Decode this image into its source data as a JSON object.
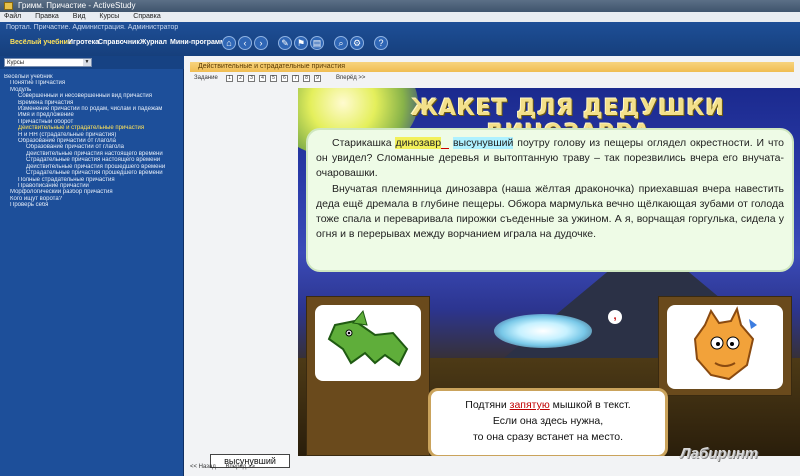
{
  "window": {
    "title": "Гримм. Причастие - ActiveStudy"
  },
  "menubar": [
    "Файл",
    "Правка",
    "Вид",
    "Курсы",
    "Справка"
  ],
  "header": {
    "subtitle": "Портал. Причастие. Администрация. Администратор",
    "tabs": [
      {
        "label": "Весёлый учебник",
        "active": true
      },
      {
        "label": "Игротека",
        "active": false
      },
      {
        "label": "Справочник",
        "active": false
      },
      {
        "label": "Журнал",
        "active": false
      },
      {
        "label": "Мини-программа",
        "active": false
      }
    ],
    "toolbar_icons": [
      "home-icon",
      "back-icon",
      "forward-icon",
      "tools-icon",
      "bookmark-icon",
      "print-icon",
      "search-icon",
      "settings-icon",
      "help-icon"
    ]
  },
  "sidebar": {
    "combo": "Курсы",
    "items": [
      {
        "label": "Весёлый учебник",
        "level": 0
      },
      {
        "label": "Понятие Причастия",
        "level": 1
      },
      {
        "label": "Модуль",
        "level": 1
      },
      {
        "label": "Совершенный и несовершенный вид причастия",
        "level": 2
      },
      {
        "label": "Времена причастия",
        "level": 2
      },
      {
        "label": "Изменение причастий по родам, числам и падежам",
        "level": 2
      },
      {
        "label": "Имя и предложение",
        "level": 2
      },
      {
        "label": "Причастный оборот",
        "level": 2
      },
      {
        "label": "Действительные и страдательные причастия",
        "level": 2,
        "selected": true
      },
      {
        "label": "Н и НН (страдательные причастия)",
        "level": 2
      },
      {
        "label": "Образование причастий от глагола",
        "level": 2
      },
      {
        "label": "Образование причастий от глагола",
        "level": 3
      },
      {
        "label": "Действительные причастия настоящего времени",
        "level": 3
      },
      {
        "label": "Страдательные причастия настоящего времени",
        "level": 3
      },
      {
        "label": "Действительные причастия прошедшего времени",
        "level": 3
      },
      {
        "label": "Страдательные причастия прошедшего времени",
        "level": 3
      },
      {
        "label": "Полные страдательные причастия",
        "level": 2
      },
      {
        "label": "Правописание причастий",
        "level": 2
      },
      {
        "label": "Морфологический разбор причастия",
        "level": 1
      },
      {
        "label": "Кого ищут ворота?",
        "level": 1
      },
      {
        "label": "Проверь себя",
        "level": 1
      }
    ]
  },
  "lesson": {
    "topic": "Действительные и страдательные причастия",
    "nav_label": "Задание",
    "nav_pages": [
      "1",
      "2",
      "3",
      "4",
      "5",
      "6",
      "7",
      "8",
      "9"
    ],
    "next_label": "Вперёд >>",
    "title": "ЖАКЕТ ДЛЯ ДЕДУШКИ ДИНОЗАВРА",
    "para1_a": "Старикашка ",
    "para1_hl1": "динозавр",
    "para1_b": " ",
    "para1_hl2": "высунувший",
    "para1_c": " поутру голову из пещеры огляд­ел окрестности. И что он увидел? Сломанные деревья и вытоптанную траву – так порезвились вчера его внучата-очаровашки.",
    "para2": "Внучатая племянница динозавра (наша жёлтая драконочка) приехавшая вчера навестить деда ещё дремала в глубине пещеры. Обжора мармулька вечно щёлкающая зубами от голода тоже спала и переваривала пирожки съеденные за ужином. А я, ворчащая горгулька, сидела у огня и в перерывах между ворчанием играла на дудочке.",
    "comma": ",",
    "instruction_1": "Подтяни ",
    "instruction_red": "запятую",
    "instruction_2": " мышкой в текст.",
    "instruction_3": "Если она здесь нужна,",
    "instruction_4": "то она сразу встанет на место.",
    "word_chip": "высунувший"
  },
  "bottom_nav": [
    "<< Назад",
    "Вперёд >>"
  ],
  "watermark": "Лабиринт"
}
